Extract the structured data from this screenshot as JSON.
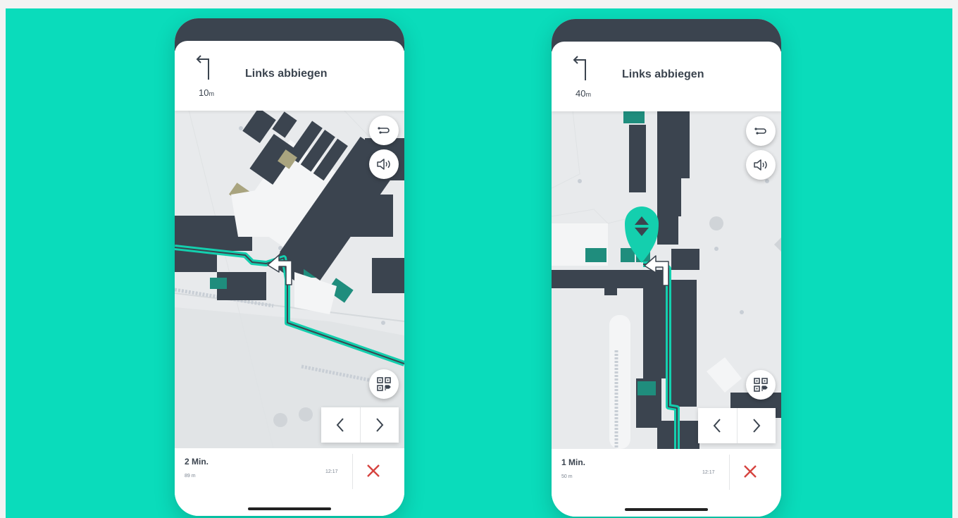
{
  "colors": {
    "background": "#0adcbb",
    "route": "#14cfae",
    "building": "#3b444f",
    "close": "#d6433f"
  },
  "phones": [
    {
      "instruction": "Links abbiegen",
      "distance_value": "10",
      "distance_unit": "m",
      "eta": "2 Min.",
      "remaining": "89 m",
      "arrival_time": "12:17",
      "icons": [
        "turn-left-icon",
        "route-options-icon",
        "speaker-icon",
        "qr-code-icon",
        "arrow-left-icon",
        "arrow-right-icon",
        "close-icon"
      ]
    },
    {
      "instruction": "Links abbiegen",
      "distance_value": "40",
      "distance_unit": "m",
      "eta": "1 Min.",
      "remaining": "50 m",
      "arrival_time": "12:17",
      "icons": [
        "turn-left-icon",
        "route-options-icon",
        "speaker-icon",
        "location-pin-icon",
        "qr-code-icon",
        "arrow-left-icon",
        "arrow-right-icon",
        "close-icon"
      ]
    }
  ]
}
